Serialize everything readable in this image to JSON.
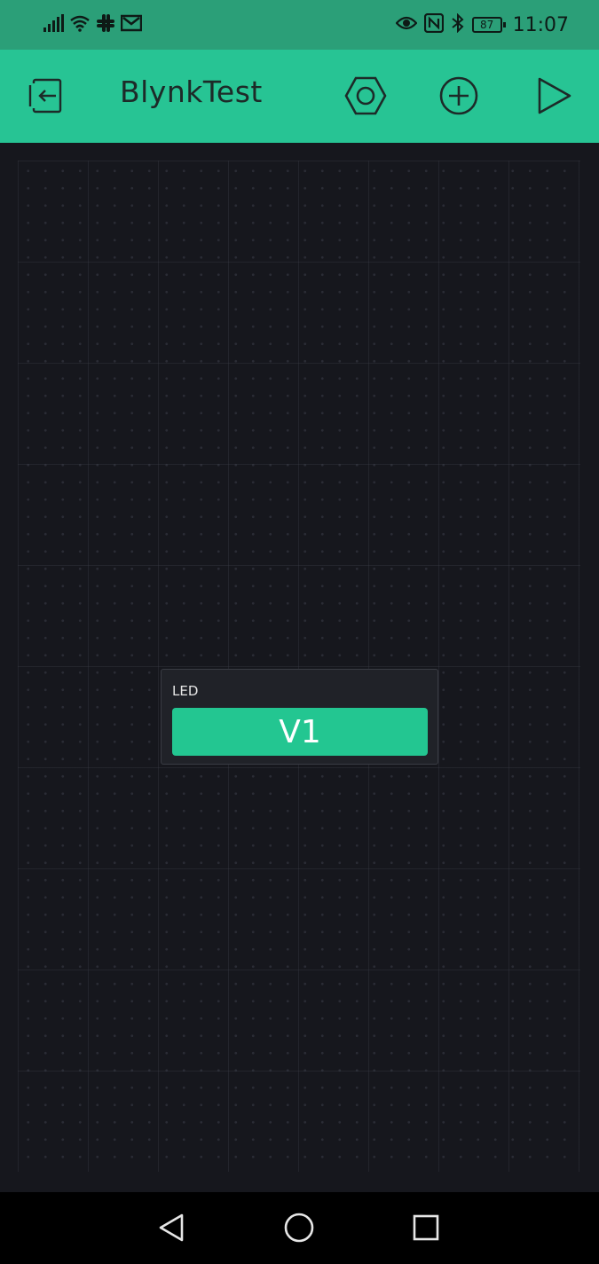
{
  "status_bar": {
    "time": "11:07",
    "battery_level": "87",
    "left_icons": [
      "signal-icon",
      "wifi-icon",
      "slack-icon",
      "gmail-icon"
    ],
    "right_icons": [
      "eye-icon",
      "nfc-icon",
      "bluetooth-icon",
      "battery-icon"
    ]
  },
  "app_bar": {
    "title": "BlynkTest",
    "icons": [
      "exit-project-icon",
      "settings-hex-icon",
      "add-widget-icon",
      "play-icon"
    ]
  },
  "widget": {
    "label": "LED",
    "pin": "V1"
  },
  "nav_bar": {
    "icons": [
      "back-icon",
      "home-icon",
      "recents-icon"
    ]
  },
  "colors": {
    "status_bar": "#2b9f78",
    "app_bar": "#27c494",
    "canvas": "#16171d",
    "widget_pin": "#23c691"
  }
}
